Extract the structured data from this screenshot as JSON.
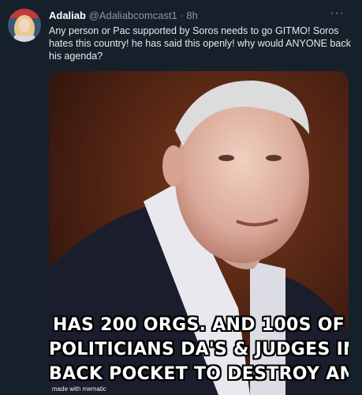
{
  "tweet": {
    "display_name": "Adaliab",
    "handle": "@Adaliabcomcast1",
    "separator": "·",
    "time": "8h",
    "more_icon": "···",
    "text": "Any person or Pac supported by Soros needs to go GITMO! Soros hates this country! he has said this openly! why would ANYONE back his agenda?"
  },
  "media": {
    "caption_lines": [
      "HAS 200 ORGS. AND 100S OF",
      "POLITICIANS DA'S & JUDGES IN HIS",
      "BACK POCKET TO DESTROY AMERICA"
    ],
    "watermark": "made with mematic"
  },
  "colors": {
    "background": "#15202b",
    "text_primary": "#e7e9ea",
    "text_secondary": "#8b98a5"
  }
}
